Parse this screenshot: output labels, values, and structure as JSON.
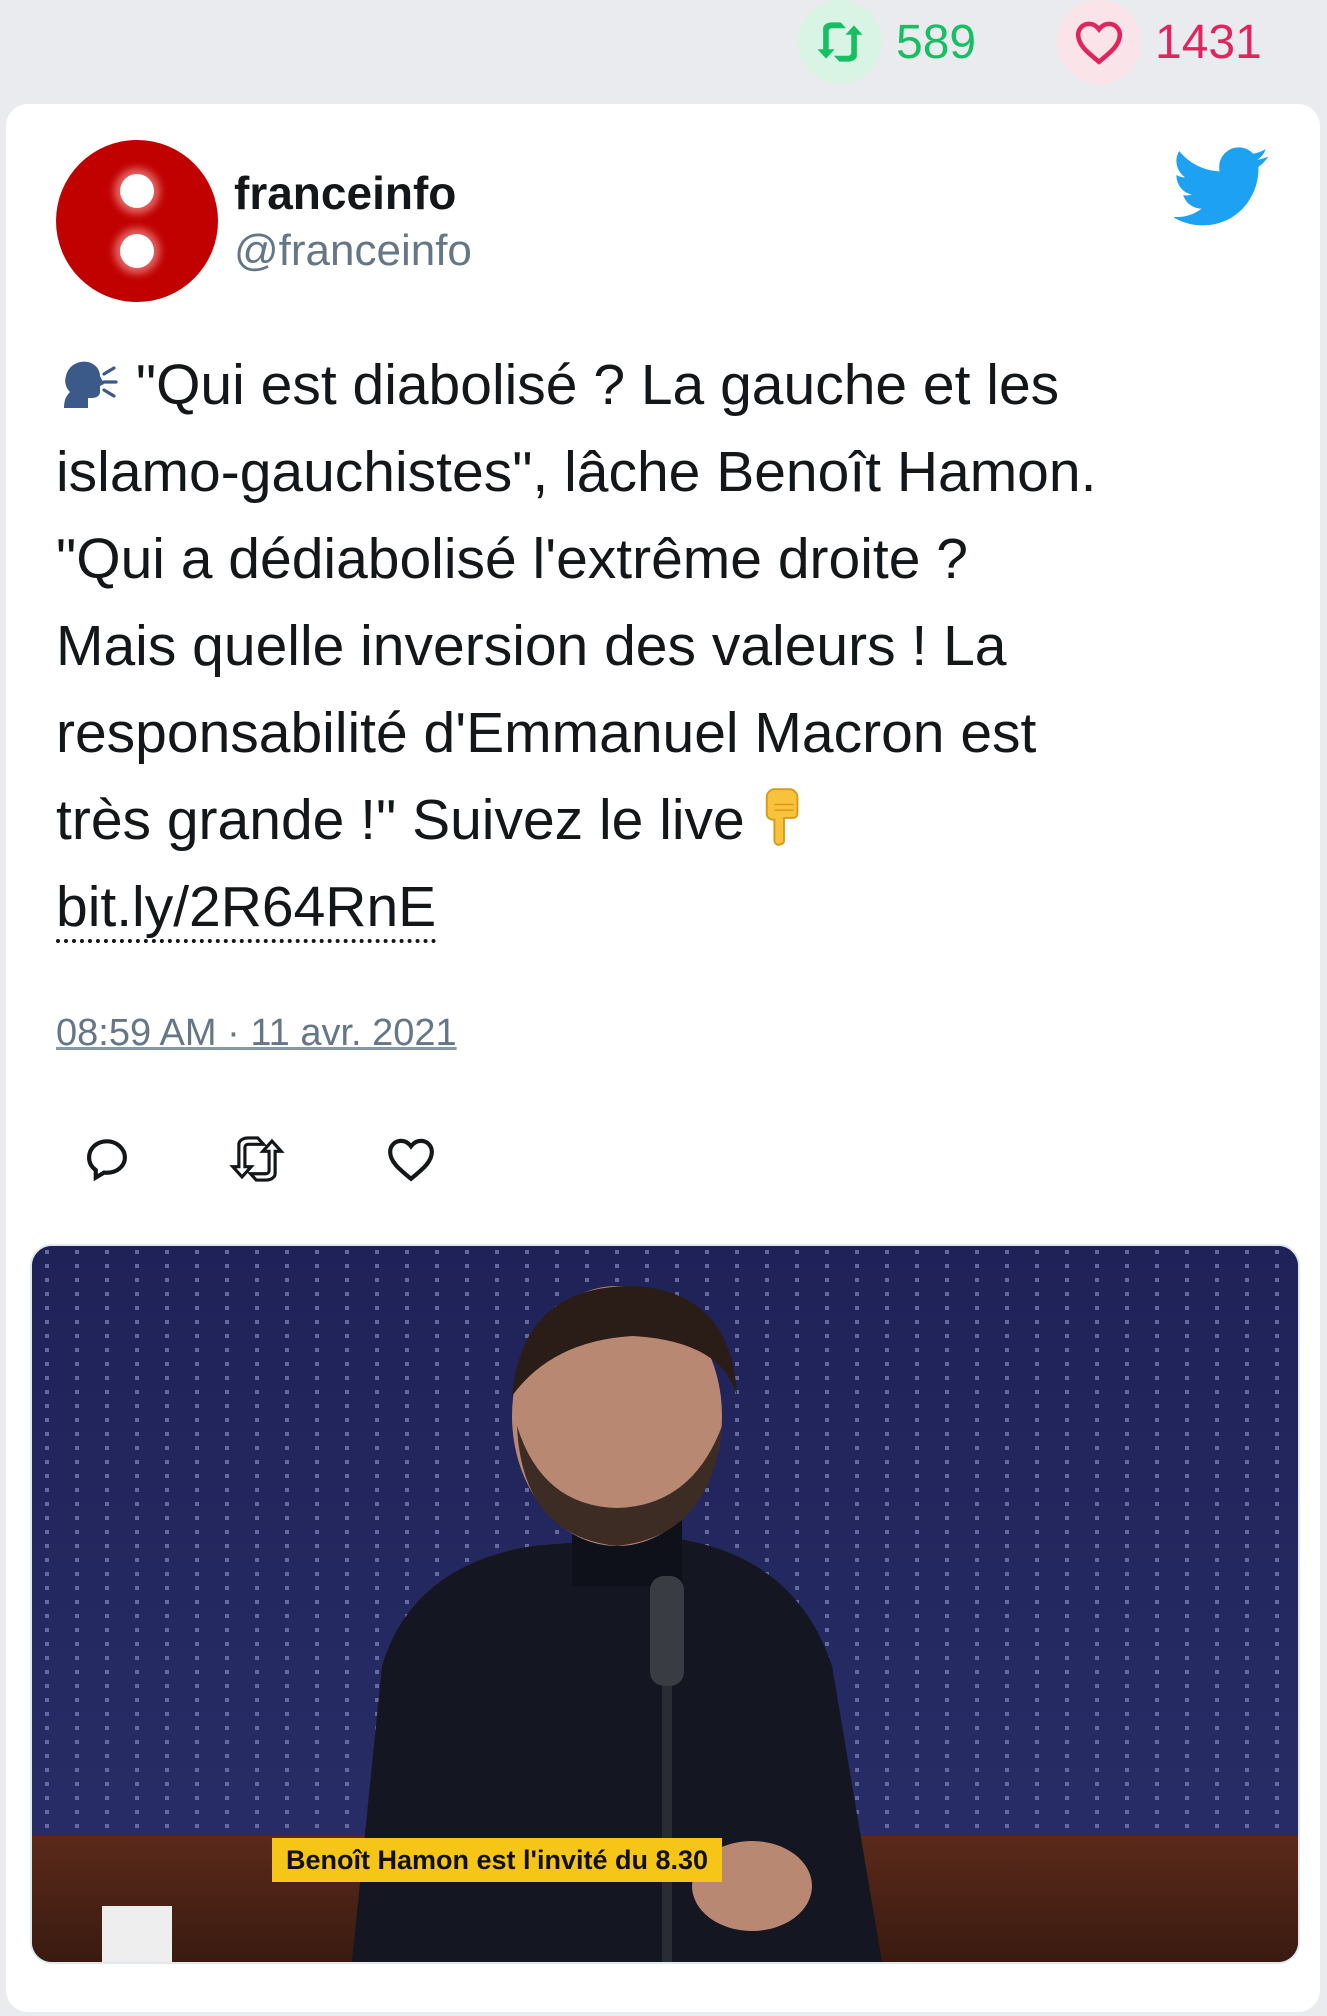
{
  "stats": {
    "retweets": "589",
    "likes": "1431",
    "retweet_icon": "retweet-icon",
    "like_icon": "heart-icon",
    "retweet_color": "#17bf63",
    "like_color": "#e0245e"
  },
  "tweet": {
    "author": {
      "display_name": "franceinfo",
      "handle": "@franceinfo",
      "avatar_color": "#c10000"
    },
    "text_lines": [
      "\"Qui est diabolisé ? La gauche et les",
      "islamo-gauchistes\", lâche Benoît Hamon.",
      "\"Qui a dédiabolisé l'extrême droite ?",
      "Mais quelle inversion des valeurs ! La",
      "responsabilité d'Emmanuel Macron est",
      "très grande !\" Suivez le live"
    ],
    "link": "bit.ly/2R64RnE",
    "leading_emoji": "speaking-head-emoji",
    "trailing_emoji": "backhand-index-pointing-down-emoji",
    "timestamp": "08:59 AM · 11 avr. 2021",
    "actions": [
      "reply-icon",
      "retweet-icon",
      "like-icon"
    ],
    "media": {
      "caption": "Benoît Hamon est l'invité du 8.30",
      "caption_color": "#f5c518"
    },
    "brand_color": "#1da1f2"
  }
}
